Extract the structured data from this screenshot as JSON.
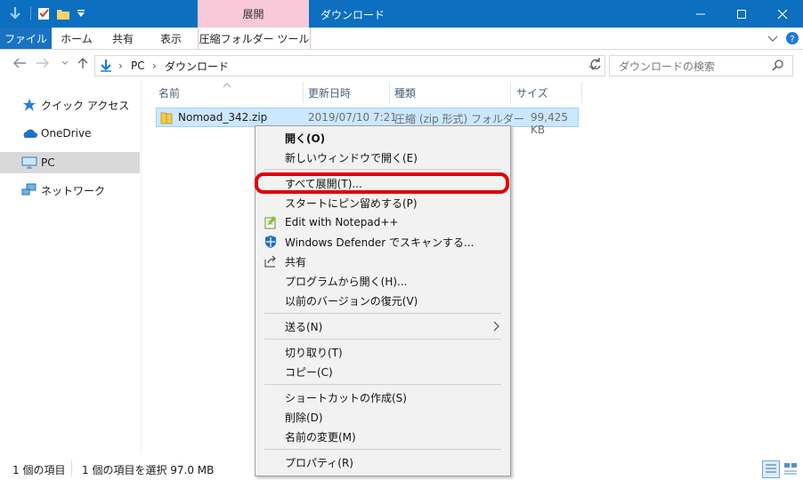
{
  "titlebar": {
    "tab_extract": "展開",
    "window_title": "ダウンロード"
  },
  "ribbon": {
    "tabs": [
      "ファイル",
      "ホーム",
      "共有",
      "表示",
      "圧縮フォルダー ツール"
    ]
  },
  "address": {
    "path": [
      "PC",
      "ダウンロード"
    ],
    "search_placeholder": "ダウンロードの検索"
  },
  "nav": {
    "items": [
      "クイック アクセス",
      "OneDrive",
      "PC",
      "ネットワーク"
    ]
  },
  "columns": [
    "名前",
    "更新日時",
    "種類",
    "サイズ"
  ],
  "file": {
    "name": "Nomoad_342.zip",
    "modified": "2019/07/10 7:21",
    "type": "圧縮 (zip 形式) フォルダー",
    "size": "99,425 KB"
  },
  "status": {
    "count": "1 個の項目",
    "selected": "1 個の項目を選択 97.0 MB"
  },
  "context_menu": {
    "items": [
      "開く(O)",
      "新しいウィンドウで開く(E)",
      "すべて展開(T)...",
      "スタートにピン留めする(P)",
      "Edit with Notepad++",
      "Windows Defender でスキャンする...",
      "共有",
      "プログラムから開く(H)...",
      "以前のバージョンの復元(V)",
      "送る(N)",
      "切り取り(T)",
      "コピー(C)",
      "ショートカットの作成(S)",
      "削除(D)",
      "名前の変更(M)",
      "プロパティ(R)"
    ]
  },
  "colors": {
    "titlebar": "#0c6fbf",
    "extract_tab": "#f7c9d9",
    "selection": "#cce8ff",
    "highlight_ring": "#e00000"
  }
}
